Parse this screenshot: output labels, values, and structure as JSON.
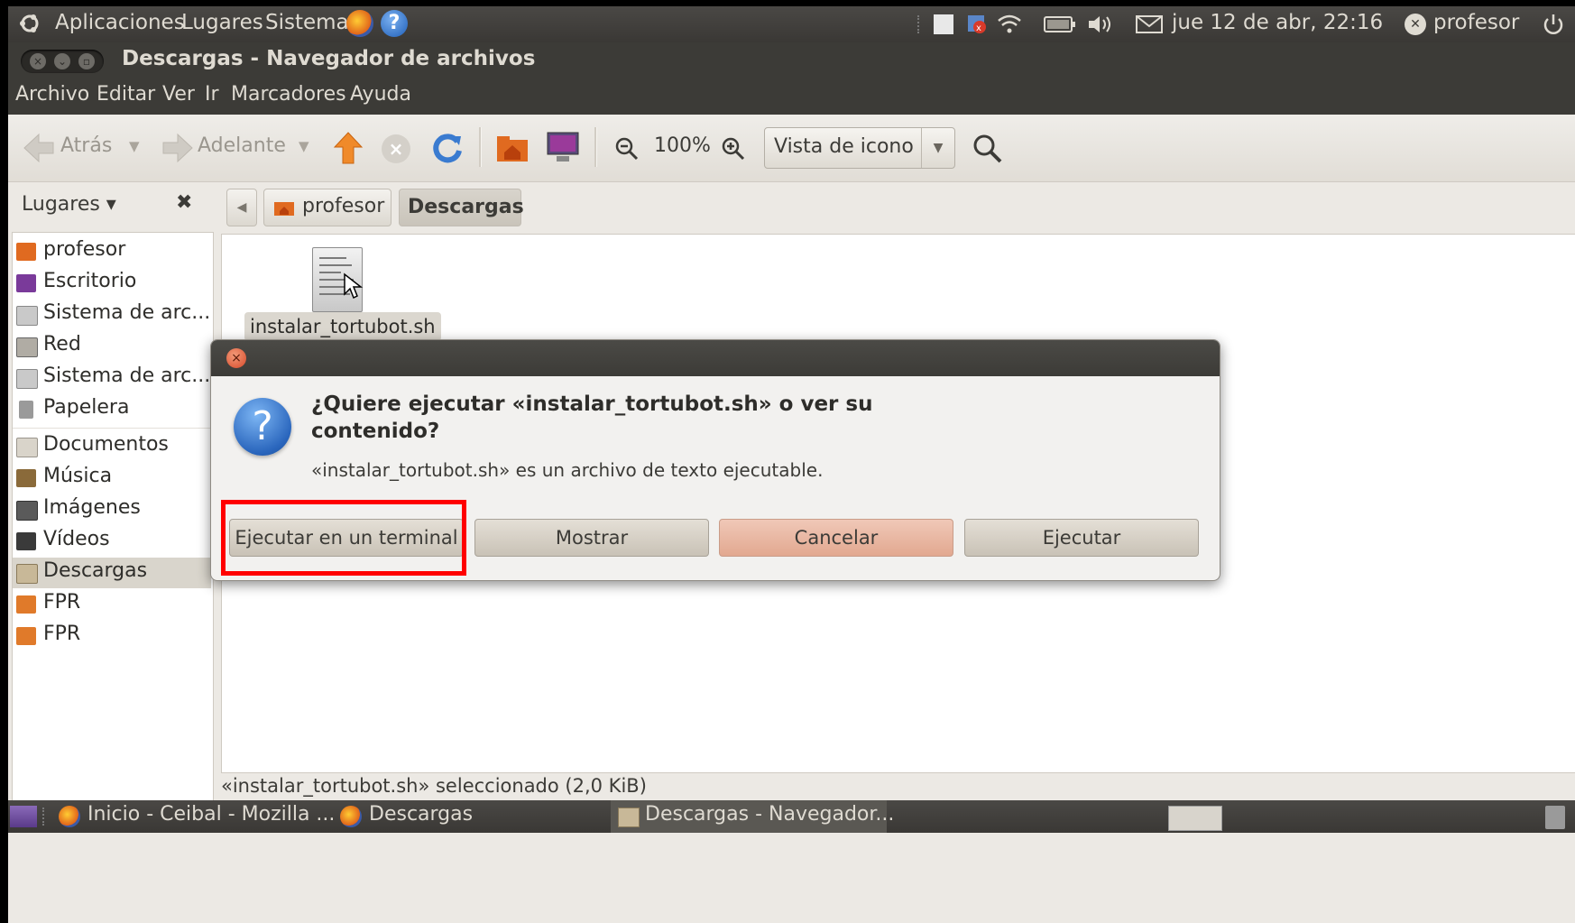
{
  "top_panel": {
    "menus": [
      "Aplicaciones",
      "Lugares",
      "Sistema"
    ],
    "datetime": "jue 12 de abr, 22:16",
    "user": "profesor"
  },
  "window": {
    "title": "Descargas - Navegador de archivos",
    "menubar": [
      "Archivo",
      "Editar",
      "Ver",
      "Ir",
      "Marcadores",
      "Ayuda"
    ]
  },
  "toolbar": {
    "back": "Atrás",
    "forward": "Adelante",
    "zoom": "100%",
    "view_mode": "Vista de icono"
  },
  "location": {
    "places_label": "Lugares ▾",
    "crumbs": [
      "profesor",
      "Descargas"
    ]
  },
  "sidebar": {
    "items": [
      "profesor",
      "Escritorio",
      "Sistema de arc...",
      "Red",
      "Sistema de arc...",
      "Papelera",
      "Documentos",
      "Música",
      "Imágenes",
      "Vídeos",
      "Descargas",
      "FPR",
      "FPR"
    ]
  },
  "files": [
    {
      "name": "instalar_tortubot.sh"
    }
  ],
  "status": "«instalar_tortubot.sh» seleccionado (2,0 KiB)",
  "dialog": {
    "heading": "¿Quiere ejecutar «instalar_tortubot.sh» o ver su contenido?",
    "message": "«instalar_tortubot.sh» es un archivo de texto ejecutable.",
    "buttons": [
      "Ejecutar en un terminal",
      "Mostrar",
      "Cancelar",
      "Ejecutar"
    ]
  },
  "taskbar": {
    "tasks": [
      "Inicio - Ceibal - Mozilla ...",
      "Descargas",
      "Descargas - Navegador..."
    ]
  }
}
